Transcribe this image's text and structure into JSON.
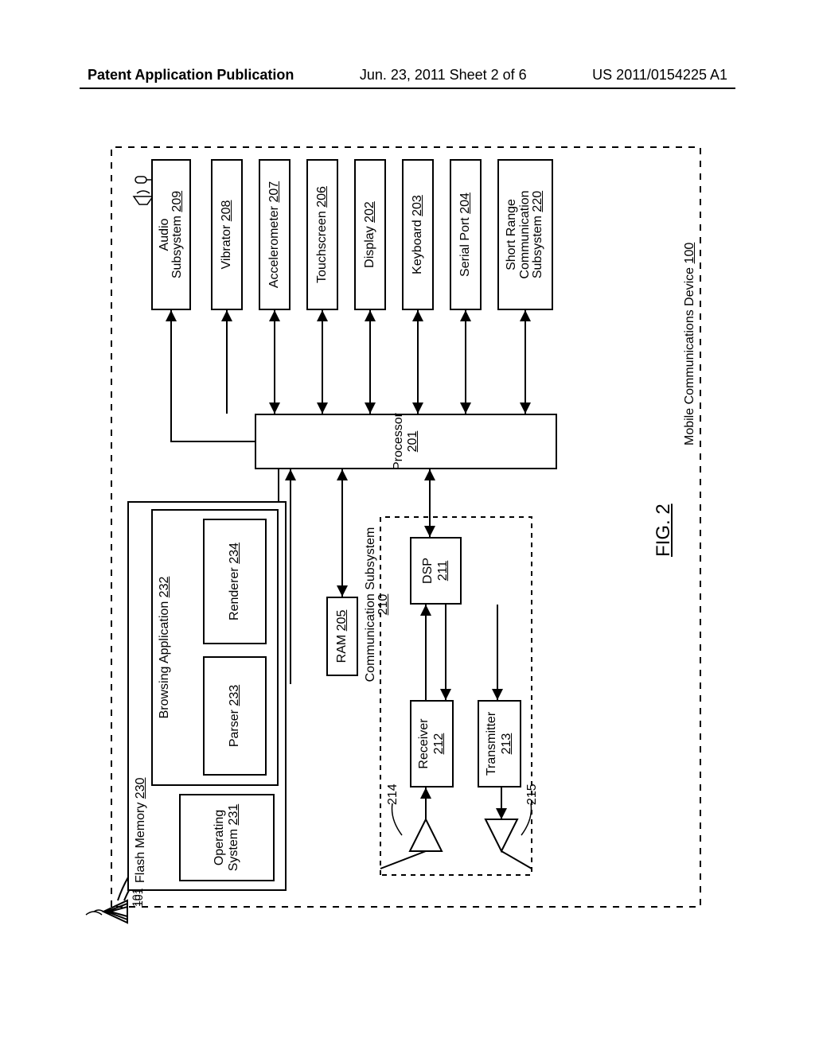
{
  "header": {
    "left": "Patent Application Publication",
    "center": "Jun. 23, 2011  Sheet 2 of 6",
    "right": "US 2011/0154225 A1"
  },
  "figure_label": "FIG. 2",
  "device_boundary": {
    "title": "Mobile Communications Device",
    "ref": "100"
  },
  "comm_subsystem": {
    "title": "Communication Subsystem",
    "ref": "210"
  },
  "antenna_ref": "101",
  "flash_memory": {
    "label": "Flash Memory",
    "ref": "230"
  },
  "operating_system": {
    "label_line1": "Operating",
    "label_line2": "System",
    "ref": "231"
  },
  "browsing_app": {
    "label": "Browsing Application",
    "ref": "232"
  },
  "parser": {
    "label": "Parser",
    "ref": "233"
  },
  "renderer": {
    "label": "Renderer",
    "ref": "234"
  },
  "ram": {
    "label": "RAM",
    "ref": "205"
  },
  "processor": {
    "label": "Processor",
    "ref": "201"
  },
  "audio": {
    "label_line1": "Audio",
    "label_line2": "Subsystem",
    "ref": "209"
  },
  "vibrator": {
    "label": "Vibrator",
    "ref": "208"
  },
  "accelerometer": {
    "label": "Accelerometer",
    "ref": "207"
  },
  "touchscreen": {
    "label": "Touchscreen",
    "ref": "206"
  },
  "display": {
    "label": "Display",
    "ref": "202"
  },
  "keyboard": {
    "label": "Keyboard",
    "ref": "203"
  },
  "serial_port": {
    "label": "Serial Port",
    "ref": "204"
  },
  "short_range": {
    "label_line1": "Short Range",
    "label_line2": "Communication",
    "label_line3": "Subsystem",
    "ref": "220"
  },
  "dsp": {
    "label": "DSP",
    "ref": "211"
  },
  "receiver": {
    "label": "Receiver",
    "ref": "212"
  },
  "transmitter": {
    "label": "Transmitter",
    "ref": "213"
  },
  "amp_rx_ref": "214",
  "amp_tx_ref": "215"
}
